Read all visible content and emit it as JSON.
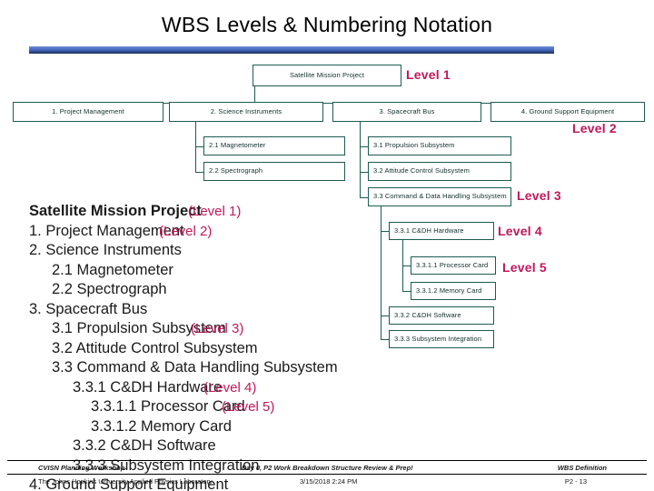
{
  "slide": {
    "title": "WBS Levels & Numbering Notation",
    "accent_color": "#c2185b",
    "rule_color": "#4a6ec0",
    "node_border_color": "#1d5b52"
  },
  "orgchart": {
    "level1": {
      "label": "Satellite Mission Project"
    },
    "level2": [
      {
        "label": "1. Project Management"
      },
      {
        "label": "2. Science Instruments"
      },
      {
        "label": "3. Spacecraft Bus"
      },
      {
        "label": "4. Ground Support Equipment"
      }
    ],
    "science_children": [
      {
        "label": "2.1 Magnetometer"
      },
      {
        "label": "2.2 Spectrograph"
      }
    ],
    "bus_children": [
      {
        "label": "3.1 Propulsion Subsystem"
      },
      {
        "label": "3.2 Attitude Control Subsystem"
      },
      {
        "label": "3.3 Command & Data Handling Subsystem"
      }
    ],
    "cdh_children": [
      {
        "label": "3.3.1 C&DH Hardware"
      },
      {
        "label": "3.3.2 C&DH Software"
      },
      {
        "label": "3.3.3 Subsystem Integration"
      }
    ],
    "hardware_children": [
      {
        "label": "3.3.1.1  Processor Card"
      },
      {
        "label": "3.3.1.2  Memory Card"
      }
    ],
    "level_tags": [
      {
        "label": "Level 1"
      },
      {
        "label": "Level 2"
      },
      {
        "label": "Level 3"
      },
      {
        "label": "Level 4"
      },
      {
        "label": "Level 5"
      }
    ]
  },
  "outline": {
    "rows": [
      {
        "text": "Satellite Mission Project",
        "note": "(Level 1)"
      },
      {
        "text": "1. Project Management",
        "note": "(Level 2)"
      },
      {
        "text": "2. Science Instruments",
        "note": ""
      },
      {
        "text": "2.1 Magnetometer",
        "note": ""
      },
      {
        "text": "2.2 Spectrograph",
        "note": ""
      },
      {
        "text": "3. Spacecraft Bus",
        "note": ""
      },
      {
        "text": "3.1 Propulsion Subsystem",
        "note": "(Level 3)"
      },
      {
        "text": "3.2 Attitude Control Subsystem",
        "note": ""
      },
      {
        "text": "3.3 Command & Data Handling Subsystem",
        "note": ""
      },
      {
        "text": "3.3.1 C&DH Hardware",
        "note": "(Level 4)"
      },
      {
        "text": "3.3.1.1 Processor Card",
        "note": "(Level 5)"
      },
      {
        "text": "3.3.1.2 Memory Card",
        "note": ""
      },
      {
        "text": "3.3.2 C&DH Software",
        "note": ""
      },
      {
        "text": "3.3.3 Subsystem Integration",
        "note": ""
      },
      {
        "text": "4. Ground Support Equipment",
        "note": ""
      }
    ]
  },
  "footer": {
    "top_left": "CVISN Planning Workshop",
    "top_center": "Day 0, P2 Work Breakdown Structure Review & Prep!",
    "top_right": "WBS Definition",
    "bottom_left": "The Johns Hopkins University Applied Physics Laboratory",
    "bottom_center": "3/15/2018 2:24 PM",
    "bottom_right": "P2 - 13"
  }
}
